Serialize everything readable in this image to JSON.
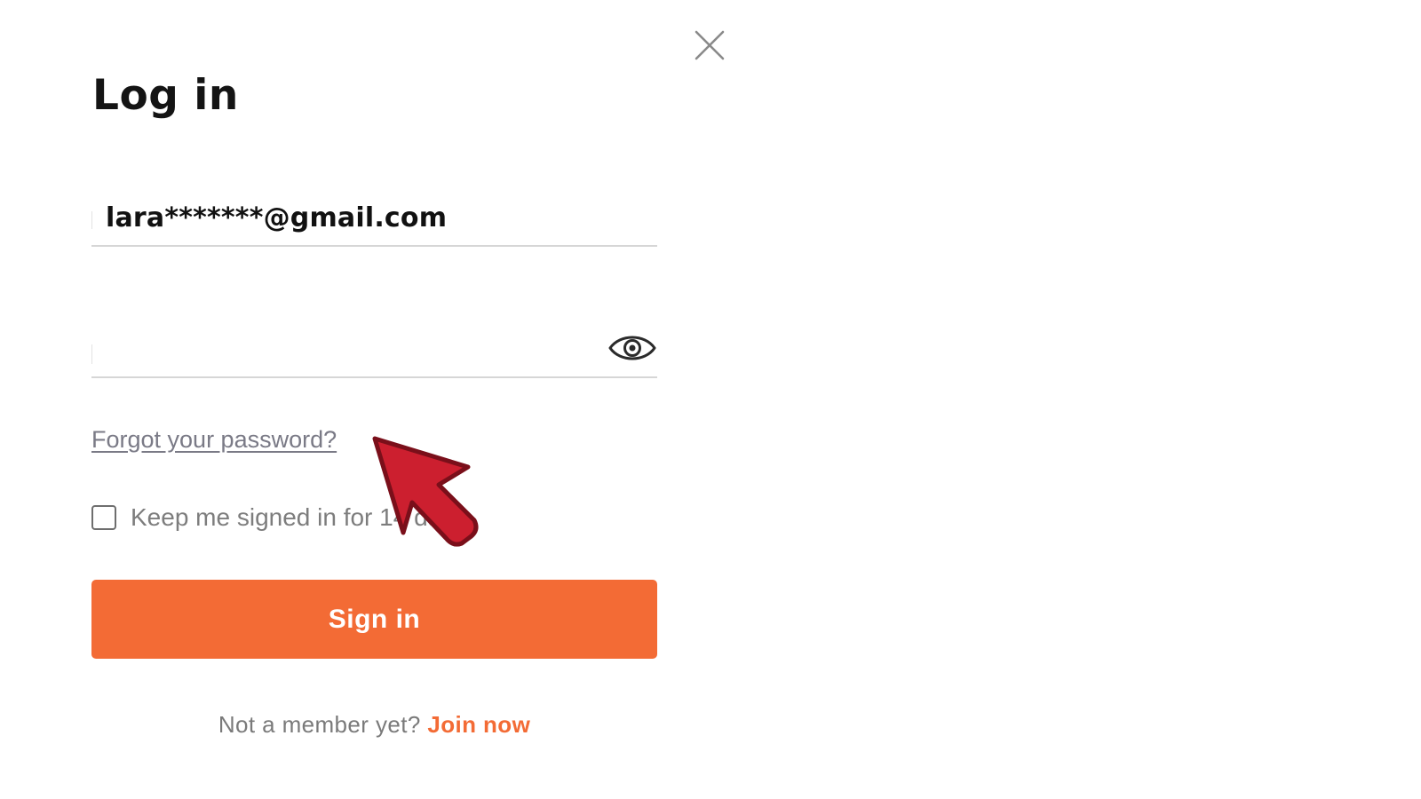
{
  "dialog": {
    "title": "Log in",
    "close_icon": "close-icon"
  },
  "email": {
    "value": "lara*******@gmail.com"
  },
  "password": {
    "value": "",
    "toggle_icon": "eye-icon"
  },
  "links": {
    "forgot_password": "Forgot your password?"
  },
  "keep_signed_in": {
    "label": "Keep me signed in for 14 days",
    "checked": false
  },
  "signin_button": {
    "label": "Sign in"
  },
  "footer": {
    "prompt": "Not a member yet?",
    "join_label": "Join now"
  },
  "annotation": {
    "icon": "red-arrow-pointer-icon"
  },
  "colors": {
    "accent": "#f36b35",
    "arrow_fill": "#cc1f2f",
    "arrow_stroke": "#7a0f1a"
  }
}
